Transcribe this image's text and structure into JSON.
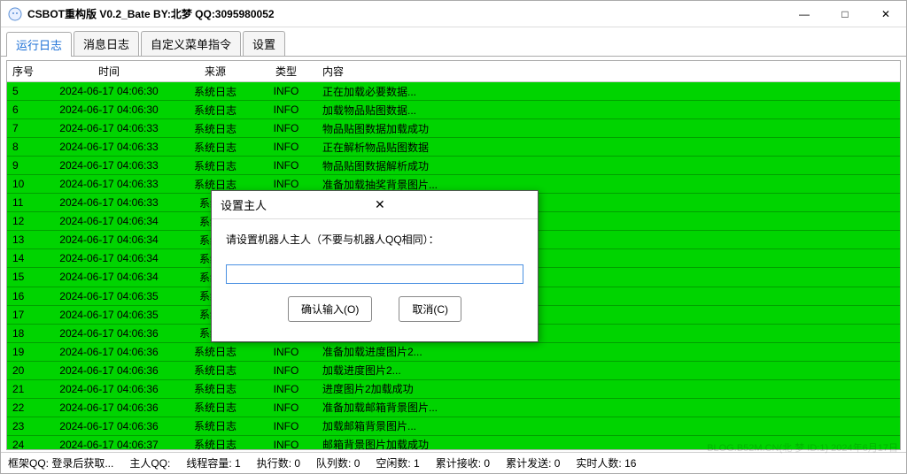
{
  "window": {
    "title": "CSBOT重构版  V0.2_Bate BY:北梦 QQ:3095980052"
  },
  "tabs": [
    {
      "label": "运行日志",
      "active": true
    },
    {
      "label": "消息日志",
      "active": false
    },
    {
      "label": "自定义菜单指令",
      "active": false
    },
    {
      "label": "设置",
      "active": false
    }
  ],
  "columns": {
    "seq": "序号",
    "time": "时间",
    "source": "来源",
    "type": "类型",
    "content": "内容"
  },
  "rows": [
    {
      "seq": "5",
      "time": "2024-06-17 04:06:30",
      "source": "系统日志",
      "type": "INFO",
      "content": "正在加载必要数据..."
    },
    {
      "seq": "6",
      "time": "2024-06-17 04:06:30",
      "source": "系统日志",
      "type": "INFO",
      "content": "加载物品贴图数据..."
    },
    {
      "seq": "7",
      "time": "2024-06-17 04:06:33",
      "source": "系统日志",
      "type": "INFO",
      "content": "物品贴图数据加载成功"
    },
    {
      "seq": "8",
      "time": "2024-06-17 04:06:33",
      "source": "系统日志",
      "type": "INFO",
      "content": "正在解析物品贴图数据"
    },
    {
      "seq": "9",
      "time": "2024-06-17 04:06:33",
      "source": "系统日志",
      "type": "INFO",
      "content": "物品贴图数据解析成功"
    },
    {
      "seq": "10",
      "time": "2024-06-17 04:06:33",
      "source": "系统日志",
      "type": "INFO",
      "content": "准备加载抽奖背景图片..."
    },
    {
      "seq": "11",
      "time": "2024-06-17 04:06:33",
      "source": "系统日",
      "type": "",
      "content": ""
    },
    {
      "seq": "12",
      "time": "2024-06-17 04:06:34",
      "source": "系统日",
      "type": "",
      "content": ""
    },
    {
      "seq": "13",
      "time": "2024-06-17 04:06:34",
      "source": "系统日",
      "type": "",
      "content": ""
    },
    {
      "seq": "14",
      "time": "2024-06-17 04:06:34",
      "source": "系统日",
      "type": "",
      "content": ""
    },
    {
      "seq": "15",
      "time": "2024-06-17 04:06:34",
      "source": "系统日",
      "type": "",
      "content": ""
    },
    {
      "seq": "16",
      "time": "2024-06-17 04:06:35",
      "source": "系统日",
      "type": "",
      "content": ""
    },
    {
      "seq": "17",
      "time": "2024-06-17 04:06:35",
      "source": "系统日",
      "type": "",
      "content": ""
    },
    {
      "seq": "18",
      "time": "2024-06-17 04:06:36",
      "source": "系统日",
      "type": "",
      "content": ""
    },
    {
      "seq": "19",
      "time": "2024-06-17 04:06:36",
      "source": "系统日志",
      "type": "INFO",
      "content": "准备加载进度图片2..."
    },
    {
      "seq": "20",
      "time": "2024-06-17 04:06:36",
      "source": "系统日志",
      "type": "INFO",
      "content": "加载进度图片2..."
    },
    {
      "seq": "21",
      "time": "2024-06-17 04:06:36",
      "source": "系统日志",
      "type": "INFO",
      "content": "进度图片2加载成功"
    },
    {
      "seq": "22",
      "time": "2024-06-17 04:06:36",
      "source": "系统日志",
      "type": "INFO",
      "content": "准备加载邮箱背景图片..."
    },
    {
      "seq": "23",
      "time": "2024-06-17 04:06:36",
      "source": "系统日志",
      "type": "INFO",
      "content": "加载邮箱背景图片..."
    },
    {
      "seq": "24",
      "time": "2024-06-17 04:06:37",
      "source": "系统日志",
      "type": "INFO",
      "content": "邮箱背景图片加载成功"
    }
  ],
  "status": {
    "frameqq_label": "框架QQ:",
    "frameqq_value": "登录后获取...",
    "masterqq_label": "主人QQ:",
    "masterqq_value": "",
    "threadcap_label": "线程容量:",
    "threadcap_value": "1",
    "exec_label": "执行数:",
    "exec_value": "0",
    "queue_label": "队列数:",
    "queue_value": "0",
    "idle_label": "空闲数:",
    "idle_value": "1",
    "recv_label": "累计接收:",
    "recv_value": "0",
    "send_label": "累计发送:",
    "send_value": "0",
    "online_label": "实时人数:",
    "online_value": "16"
  },
  "dialog": {
    "title": "设置主人",
    "message": "请设置机器人主人（不要与机器人QQ相同）：",
    "input_value": "",
    "ok_label": "确认输入(O)",
    "cancel_label": "取消(C)"
  },
  "watermark": "BLOG.B52M.CN(北 梦 ID:1) 2024年6月17日"
}
